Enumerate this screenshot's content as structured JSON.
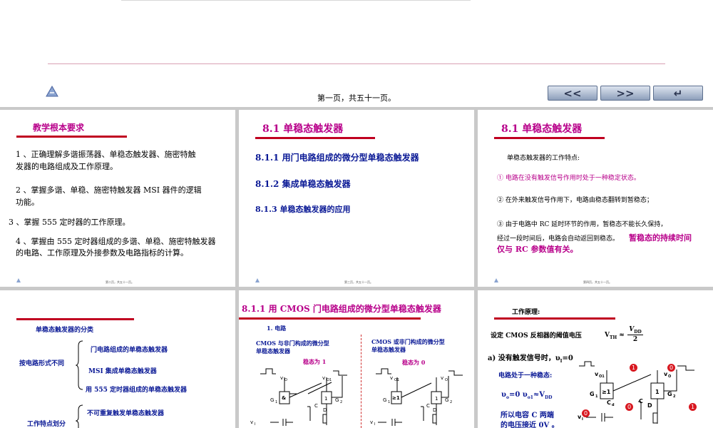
{
  "footer": {
    "page_label": "第一页，共五十一页。"
  },
  "nav": {
    "prev_label": "<<",
    "next_label": ">>",
    "return_label": "↵"
  },
  "slide1": {
    "title": "教学根本要求",
    "items": [
      "1 、正确理解多谐振荡器、单稳态触发器、施密特触",
      "发器的电路组成及工作原理。",
      "2 、掌握多谐、单稳、施密特触发器 MSI 器件的逻辑",
      "功能。",
      "3 、掌握 555 定时器的工作原理。",
      "4 、掌握由 555 定时器组成的多谐、单稳、施密特触发器",
      "的电路、工作原理及外接参数及电路指标的计算。"
    ],
    "page": "第二页，共五十一页。"
  },
  "slide2": {
    "title": "8.1 单稳态触发器",
    "items": [
      "8.1.1  用门电路组成的微分型单稳态触发器",
      "8.1.2  集成单稳态触发器",
      "8.1.3  单稳态触发器的应用"
    ],
    "page": "第三页，共五十一页。"
  },
  "slide3": {
    "title": "8.1 单稳态触发器",
    "intro": "单稳态触发器的工作特点:",
    "p1": "①   电路在没有触发信号作用时处于一种稳定状态。",
    "p2": "②   在外来触发信号作用下，电路由稳态翻转到暂稳态；",
    "p3a": "③   由于电路中 RC 延时环节的作用，暂稳态不能长久保持，",
    "p3b": "经过一段时间后，电路会自动返回到稳态。",
    "p3c": "暂稳态的持续时间",
    "p3d": "仅与 RC 参数值有关。",
    "page": "第四页，共五十一页。"
  },
  "slide4": {
    "title": "单稳态触发器的分类",
    "group1": "按电路形式不同",
    "g1_items": [
      "门电路组成的单稳态触发器",
      "MSI 集成单稳态触发器",
      "用 555 定时器组成的单稳态触发器"
    ],
    "group2": "工作特点划分",
    "g2_items": [
      "不可重复触发单稳态触发器"
    ]
  },
  "slide5": {
    "title": "8.1.1  用 CMOS 门电路组成的微分型单稳态触发器",
    "sub": "1.   电路",
    "left_caption_1": "CMOS 与非门构成的微分型",
    "left_caption_2": "单稳态触发器",
    "left_state": "稳态为 1",
    "right_caption_1": "CMOS 或非门构成的微分型",
    "right_caption_2": "单稳态触发器",
    "right_state": "稳态为 0"
  },
  "slide6": {
    "title": "工作原理:",
    "line1": "设定 CMOS 反相器的阈值电压",
    "vth": "V",
    "vth_sub": "TH",
    "approx": "≈",
    "vdd_num": "V",
    "vdd_num_sub": "DD",
    "vdd_den": "2",
    "a_label": "a) 没有触发信号时，υ",
    "a_label_sub": "I",
    "a_label_end": "=0",
    "stable": "电路处于一种稳态:",
    "eq": "υ",
    "eq_sub": "o",
    "eq2": "=0   υ",
    "eq2_sub": "o1",
    "eq3": "≈V",
    "eq3_sub": "DD",
    "c1": "所以电容 C 两端",
    "c2": "的电压接近 0V 。"
  }
}
